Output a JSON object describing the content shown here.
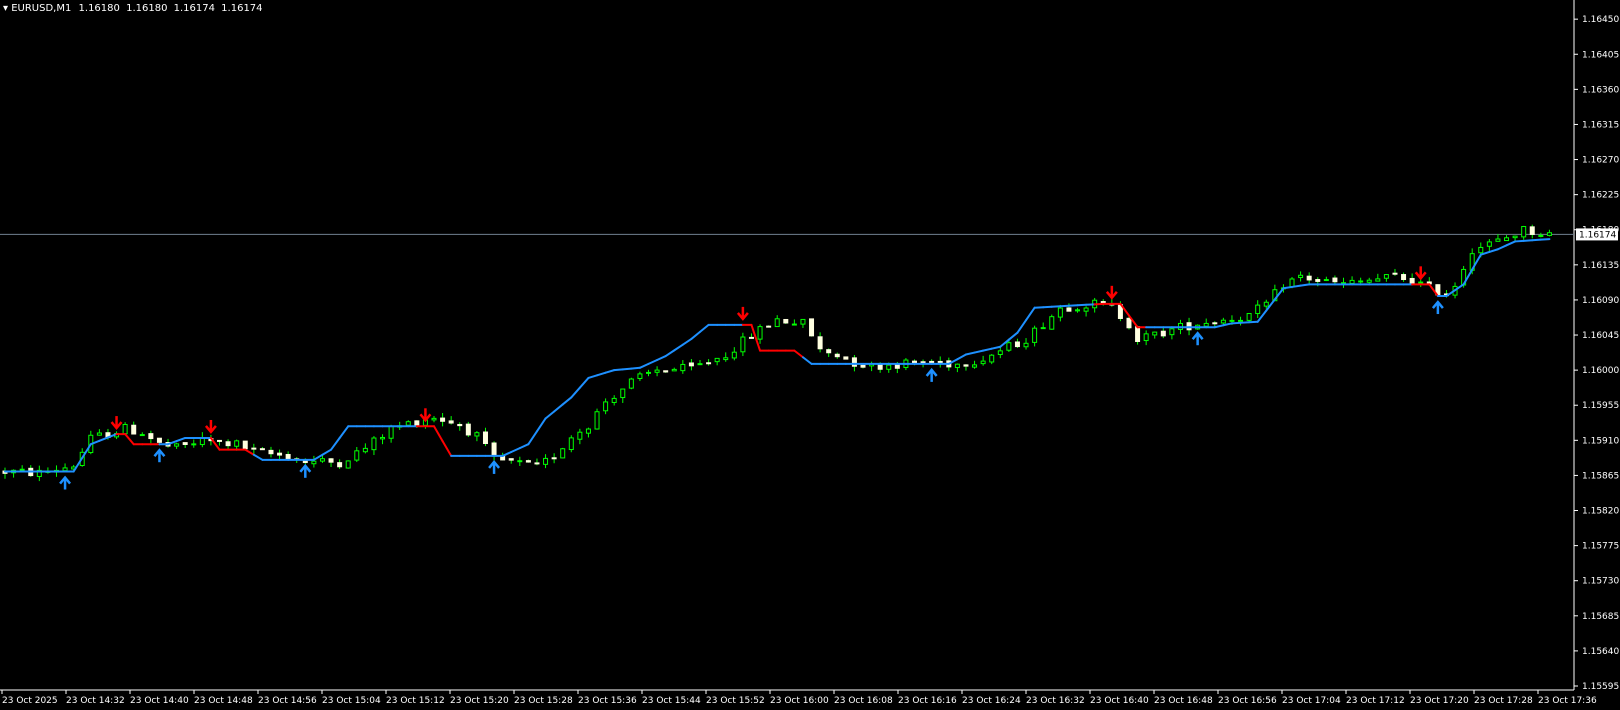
{
  "window": {
    "symbol": "EURUSD,M1",
    "ohlc": {
      "open": "1.16180",
      "high": "1.16180",
      "low": "1.16174",
      "close": "1.16174"
    },
    "menu_icon": "triangle-down-icon"
  },
  "colors": {
    "background": "#000000",
    "bull_candle": "#00ff00",
    "bull_body": "#000000",
    "bear_body": "#ffffe0",
    "trail_up": "#1e90ff",
    "trail_down": "#ff0000",
    "bid_line": "#708090",
    "axis": "#ffffff"
  },
  "chart_data": {
    "type": "candlestick",
    "symbol": "EURUSD",
    "timeframe": "M1",
    "current_price": "1.16174",
    "ylim": [
      1.15595,
      1.16472
    ],
    "price_ticks": [
      "1.16450",
      "1.16405",
      "1.16360",
      "1.16315",
      "1.16270",
      "1.16225",
      "1.16180",
      "1.16135",
      "1.16090",
      "1.16045",
      "1.16000",
      "1.15955",
      "1.15910",
      "1.15865",
      "1.15820",
      "1.15775",
      "1.15730",
      "1.15685",
      "1.15640",
      "1.15595"
    ],
    "time_ticks": [
      "23 Oct 2025",
      "23 Oct 14:32",
      "23 Oct 14:40",
      "23 Oct 14:48",
      "23 Oct 14:56",
      "23 Oct 15:04",
      "23 Oct 15:12",
      "23 Oct 15:20",
      "23 Oct 15:28",
      "23 Oct 15:36",
      "23 Oct 15:44",
      "23 Oct 15:52",
      "23 Oct 16:00",
      "23 Oct 16:08",
      "23 Oct 16:16",
      "23 Oct 16:24",
      "23 Oct 16:32",
      "23 Oct 16:40",
      "23 Oct 16:48",
      "23 Oct 16:56",
      "23 Oct 17:04",
      "23 Oct 17:12",
      "23 Oct 17:20",
      "23 Oct 17:28",
      "23 Oct 17:36"
    ],
    "close_path": [
      [
        0,
        1.1587
      ],
      [
        4,
        1.15868
      ],
      [
        8,
        1.15878
      ],
      [
        10,
        1.15912
      ],
      [
        14,
        1.15925
      ],
      [
        16,
        1.1592
      ],
      [
        18,
        1.15905
      ],
      [
        20,
        1.159
      ],
      [
        23,
        1.1591
      ],
      [
        27,
        1.15905
      ],
      [
        29,
        1.15895
      ],
      [
        33,
        1.1589
      ],
      [
        35,
        1.15883
      ],
      [
        39,
        1.15882
      ],
      [
        42,
        1.159
      ],
      [
        45,
        1.15925
      ],
      [
        48,
        1.15935
      ],
      [
        50,
        1.1594
      ],
      [
        53,
        1.1593
      ],
      [
        55,
        1.15915
      ],
      [
        57,
        1.15885
      ],
      [
        60,
        1.1588
      ],
      [
        62,
        1.15875
      ],
      [
        64,
        1.1589
      ],
      [
        66,
        1.15915
      ],
      [
        68,
        1.1593
      ],
      [
        70,
        1.1596
      ],
      [
        73,
        1.15985
      ],
      [
        76,
        1.16
      ],
      [
        80,
        1.16002
      ],
      [
        84,
        1.1602
      ],
      [
        87,
        1.16045
      ],
      [
        90,
        1.16065
      ],
      [
        93,
        1.1606
      ],
      [
        94,
        1.16045
      ],
      [
        95,
        1.16025
      ],
      [
        97,
        1.1602
      ],
      [
        99,
        1.1601
      ],
      [
        101,
        1.16005
      ],
      [
        104,
        1.16008
      ],
      [
        108,
        1.1601
      ],
      [
        111,
        1.16008
      ],
      [
        114,
        1.16015
      ],
      [
        116,
        1.16025
      ],
      [
        119,
        1.1604
      ],
      [
        121,
        1.1606
      ],
      [
        123,
        1.1608
      ],
      [
        125,
        1.16083
      ],
      [
        127,
        1.16085
      ],
      [
        129,
        1.1608
      ],
      [
        131,
        1.1606
      ],
      [
        132,
        1.1604
      ],
      [
        134,
        1.16045
      ],
      [
        137,
        1.16055
      ],
      [
        139,
        1.1606
      ],
      [
        142,
        1.16065
      ],
      [
        145,
        1.1607
      ],
      [
        147,
        1.16085
      ],
      [
        149,
        1.1611
      ],
      [
        151,
        1.1612
      ],
      [
        153,
        1.16115
      ],
      [
        156,
        1.1611
      ],
      [
        159,
        1.16115
      ],
      [
        162,
        1.1612
      ],
      [
        164,
        1.16115
      ],
      [
        166,
        1.16105
      ],
      [
        168,
        1.16098
      ],
      [
        169,
        1.1611
      ],
      [
        171,
        1.16155
      ],
      [
        174,
        1.16165
      ],
      [
        177,
        1.1618
      ],
      [
        180,
        1.16174
      ]
    ],
    "trail_path": [
      [
        0,
        1.1587
      ],
      [
        7,
        1.1587
      ],
      [
        8,
        1.1587
      ],
      [
        10,
        1.15905
      ],
      [
        13,
        1.15918
      ],
      [
        14,
        1.15918
      ],
      [
        15,
        1.15905
      ],
      [
        18,
        1.15905
      ],
      [
        19,
        1.15905
      ],
      [
        21,
        1.15913
      ],
      [
        24,
        1.15913
      ],
      [
        25,
        1.15898
      ],
      [
        28,
        1.15898
      ],
      [
        30,
        1.15885
      ],
      [
        35,
        1.15885
      ],
      [
        36,
        1.15885
      ],
      [
        38,
        1.15898
      ],
      [
        40,
        1.15928
      ],
      [
        48,
        1.15928
      ],
      [
        50,
        1.15928
      ],
      [
        52,
        1.1589
      ],
      [
        57,
        1.1589
      ],
      [
        58,
        1.1589
      ],
      [
        61,
        1.15905
      ],
      [
        63,
        1.15938
      ],
      [
        66,
        1.15965
      ],
      [
        68,
        1.1599
      ],
      [
        71,
        1.16
      ],
      [
        74,
        1.16003
      ],
      [
        77,
        1.16018
      ],
      [
        80,
        1.1604
      ],
      [
        82,
        1.16058
      ],
      [
        86,
        1.16058
      ],
      [
        87,
        1.16058
      ],
      [
        88,
        1.16025
      ],
      [
        92,
        1.16025
      ],
      [
        94,
        1.16008
      ],
      [
        109,
        1.16008
      ],
      [
        110,
        1.16008
      ],
      [
        112,
        1.1602
      ],
      [
        116,
        1.1603
      ],
      [
        118,
        1.16048
      ],
      [
        120,
        1.1608
      ],
      [
        128,
        1.16085
      ],
      [
        130,
        1.16085
      ],
      [
        132,
        1.16055
      ],
      [
        140,
        1.16055
      ],
      [
        141,
        1.16055
      ],
      [
        143,
        1.1606
      ],
      [
        146,
        1.16062
      ],
      [
        149,
        1.16105
      ],
      [
        152,
        1.1611
      ],
      [
        164,
        1.1611
      ],
      [
        166,
        1.1611
      ],
      [
        167,
        1.16095
      ],
      [
        168,
        1.16095
      ],
      [
        170,
        1.1611
      ],
      [
        172,
        1.16148
      ],
      [
        174,
        1.16155
      ],
      [
        176,
        1.16165
      ],
      [
        180,
        1.16168
      ]
    ],
    "bear_segments": [
      [
        13,
        18
      ],
      [
        24,
        29
      ],
      [
        48,
        52
      ],
      [
        86,
        93
      ],
      [
        127,
        133
      ],
      [
        164,
        167
      ]
    ],
    "buy_arrows": [
      7,
      18,
      35,
      57,
      108,
      139,
      167
    ],
    "sell_arrows": [
      13,
      24,
      49,
      86,
      129,
      165
    ]
  }
}
